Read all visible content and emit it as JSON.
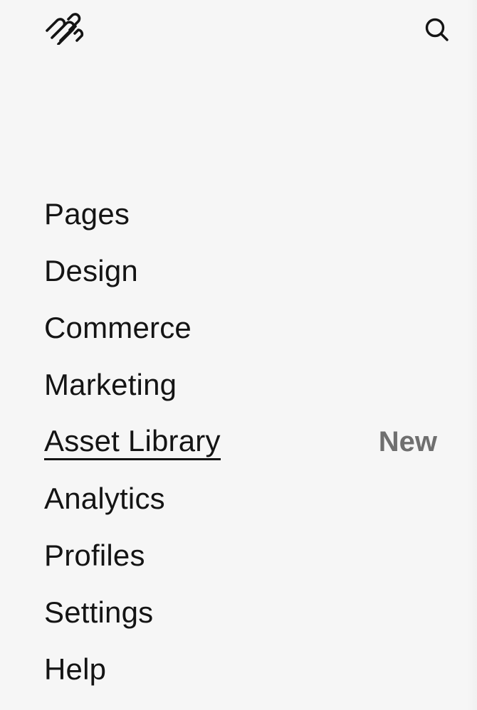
{
  "header": {
    "logo_icon": "squarespace-logo-icon",
    "search_icon": "search-icon"
  },
  "nav": {
    "items": [
      {
        "label": "Pages"
      },
      {
        "label": "Design"
      },
      {
        "label": "Commerce"
      },
      {
        "label": "Marketing"
      },
      {
        "label": "Asset Library",
        "badge": "New",
        "active": true
      },
      {
        "label": "Analytics"
      },
      {
        "label": "Profiles"
      },
      {
        "label": "Settings"
      },
      {
        "label": "Help"
      }
    ]
  },
  "colors": {
    "background": "#f6f6f6",
    "text": "#141414",
    "badge": "#6f6f6f"
  }
}
